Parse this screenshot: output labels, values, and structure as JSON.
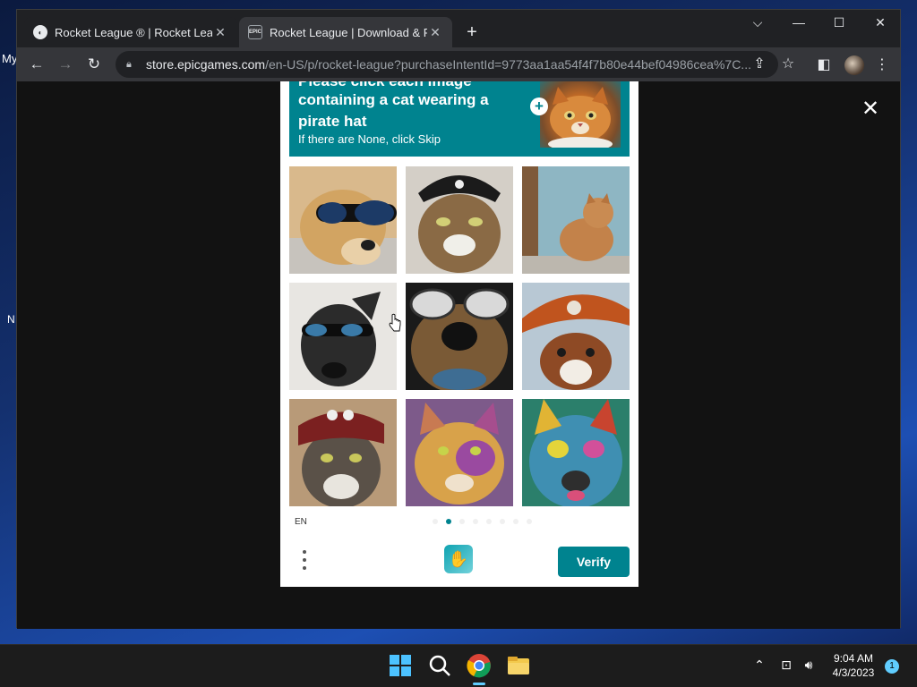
{
  "desktop": {
    "edge_label_top": "My",
    "edge_label_mid": "N"
  },
  "browser": {
    "tabs": [
      {
        "title": "Rocket League ® | Rocket League",
        "favicon": "rocket-league-favicon",
        "active": false
      },
      {
        "title": "Rocket League | Download & Play",
        "favicon": "EPIC",
        "active": true
      }
    ],
    "new_tab": "+",
    "window_controls": {
      "search_tabs": "⌵",
      "minimize": "—",
      "maximize": "☐",
      "close": "✕"
    },
    "nav": {
      "back": "←",
      "forward": "→",
      "reload": "↻"
    },
    "url": {
      "host": "store.epicgames.com",
      "path": "/en-US/p/rocket-league?purchaseIntentId=9773aa1aa54f4f7b80e44bef04986cea%7C..."
    }
  },
  "modal": {
    "close": "✕"
  },
  "captcha": {
    "prompt_clipped": "Please click each image",
    "prompt_text": "containing a cat wearing a pirate hat",
    "prompt_sub": "If there are None, click Skip",
    "sample_plus": "+",
    "images": [
      {
        "subject": "dog wearing sunglasses"
      },
      {
        "subject": "cat wearing pirate hat"
      },
      {
        "subject": "cat sitting"
      },
      {
        "subject": "black dog wearing sunglasses"
      },
      {
        "subject": "dog wearing sunglasses closeup"
      },
      {
        "subject": "dog wearing pirate hat"
      },
      {
        "subject": "cat wearing pirate bandana"
      },
      {
        "subject": "colorful cat"
      },
      {
        "subject": "colorful dog"
      }
    ],
    "language": "EN",
    "page_dots": 8,
    "active_dot": 1,
    "verify_label": "Verify"
  },
  "taskbar": {
    "time": "9:04 AM",
    "date": "4/3/2023",
    "notification_count": "1"
  },
  "colors": {
    "accent": "#00838f",
    "chrome_bg": "#202124",
    "taskbar_accent": "#60cdff"
  }
}
